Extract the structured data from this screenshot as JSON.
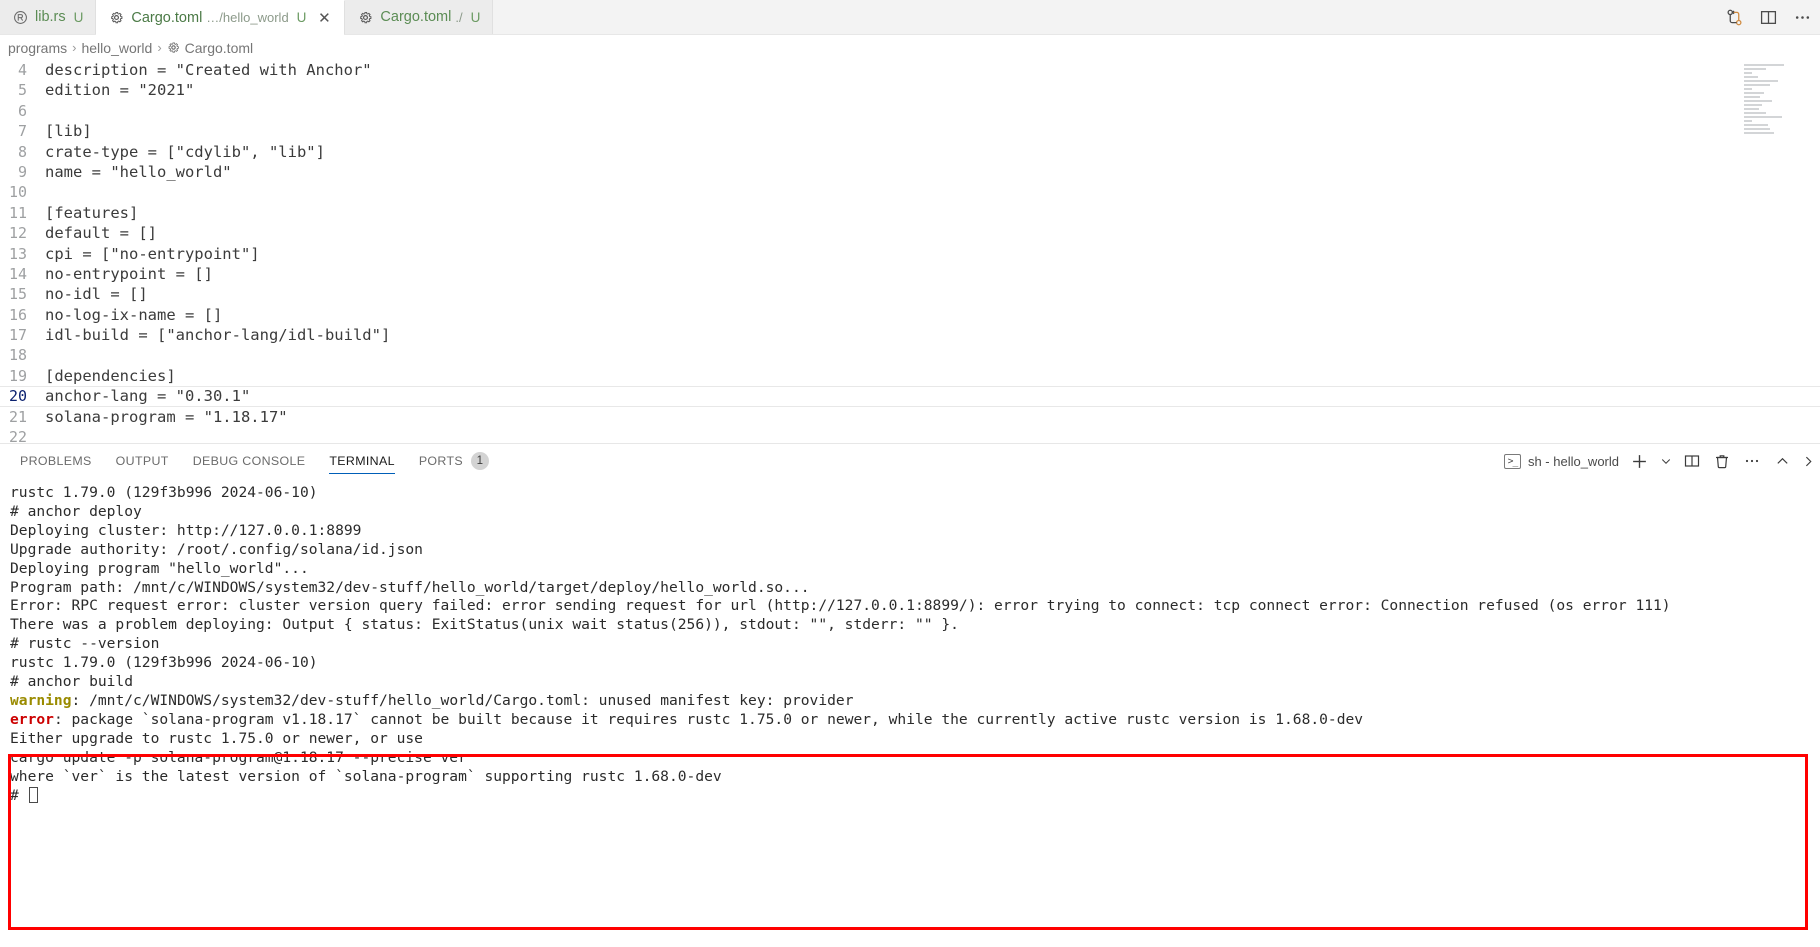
{
  "window": {
    "tabs": [
      {
        "icon": "rust-icon",
        "label": "lib.rs",
        "desc": "",
        "dirty": "U",
        "active": false,
        "closable": false
      },
      {
        "icon": "gear-icon",
        "label": "Cargo.toml",
        "desc": "…/hello_world",
        "dirty": "U",
        "active": true,
        "closable": true
      },
      {
        "icon": "gear-icon",
        "label": "Cargo.toml",
        "desc": "./",
        "dirty": "U",
        "active": false,
        "closable": false
      }
    ],
    "tabbar_actions": [
      {
        "name": "split-editor-right-icon",
        "glyph": "▥"
      },
      {
        "name": "more-actions-icon",
        "glyph": "···"
      }
    ],
    "source_control_icon": "source-control-icon"
  },
  "breadcrumb": {
    "items": [
      "programs",
      "hello_world",
      "Cargo.toml"
    ],
    "separator": "›",
    "file_icon": "gear-icon"
  },
  "editor": {
    "language": "toml",
    "active_line": 20,
    "lines": [
      {
        "n": 4,
        "text": "description = \"Created with Anchor\""
      },
      {
        "n": 5,
        "text": "edition = \"2021\""
      },
      {
        "n": 6,
        "text": ""
      },
      {
        "n": 7,
        "text": "[lib]"
      },
      {
        "n": 8,
        "text": "crate-type = [\"cdylib\", \"lib\"]"
      },
      {
        "n": 9,
        "text": "name = \"hello_world\""
      },
      {
        "n": 10,
        "text": ""
      },
      {
        "n": 11,
        "text": "[features]"
      },
      {
        "n": 12,
        "text": "default = []"
      },
      {
        "n": 13,
        "text": "cpi = [\"no-entrypoint\"]"
      },
      {
        "n": 14,
        "text": "no-entrypoint = []"
      },
      {
        "n": 15,
        "text": "no-idl = []"
      },
      {
        "n": 16,
        "text": "no-log-ix-name = []"
      },
      {
        "n": 17,
        "text": "idl-build = [\"anchor-lang/idl-build\"]"
      },
      {
        "n": 18,
        "text": ""
      },
      {
        "n": 19,
        "text": "[dependencies]"
      },
      {
        "n": 20,
        "text": "anchor-lang = \"0.30.1\""
      },
      {
        "n": 21,
        "text": "solana-program = \"1.18.17\""
      },
      {
        "n": 22,
        "text": ""
      }
    ]
  },
  "panel": {
    "tabs": [
      {
        "label": "PROBLEMS",
        "active": false,
        "badge": ""
      },
      {
        "label": "OUTPUT",
        "active": false,
        "badge": ""
      },
      {
        "label": "DEBUG CONSOLE",
        "active": false,
        "badge": ""
      },
      {
        "label": "TERMINAL",
        "active": true,
        "badge": ""
      },
      {
        "label": "PORTS",
        "active": false,
        "badge": "1"
      }
    ],
    "terminal_selector": {
      "icon": "terminal-icon",
      "icon_glyph": ">_",
      "label": "sh - hello_world"
    },
    "actions": [
      {
        "name": "new-terminal-icon",
        "glyph": "+"
      },
      {
        "name": "chevron-down-icon",
        "glyph": "⌄"
      },
      {
        "name": "split-terminal-icon",
        "glyph": "▥"
      },
      {
        "name": "kill-terminal-icon",
        "glyph": "🗑"
      },
      {
        "name": "views-and-more-actions-icon",
        "glyph": "···"
      },
      {
        "name": "maximize-panel-icon",
        "glyph": "⌃"
      },
      {
        "name": "close-panel-icon",
        "glyph": "✕"
      }
    ]
  },
  "terminal": {
    "highlight_color": "#ff0000",
    "lines": [
      {
        "segments": [
          {
            "t": "rustc 1.79.0 (129f3b996 2024-06-10)"
          }
        ]
      },
      {
        "segments": [
          {
            "t": "# anchor deploy"
          }
        ]
      },
      {
        "segments": [
          {
            "t": "Deploying cluster: http://127.0.0.1:8899"
          }
        ]
      },
      {
        "segments": [
          {
            "t": "Upgrade authority: /root/.config/solana/id.json"
          }
        ]
      },
      {
        "segments": [
          {
            "t": "Deploying program \"hello_world\"..."
          }
        ]
      },
      {
        "segments": [
          {
            "t": "Program path: /mnt/c/WINDOWS/system32/dev-stuff/hello_world/target/deploy/hello_world.so..."
          }
        ]
      },
      {
        "segments": [
          {
            "t": "Error: RPC request error: cluster version query failed: error sending request for url (http://127.0.0.1:8899/): error trying to connect: tcp connect error: Connection refused (os error 111)"
          }
        ]
      },
      {
        "segments": [
          {
            "t": "There was a problem deploying: Output { status: ExitStatus(unix wait status(256)), stdout: \"\", stderr: \"\" }."
          }
        ]
      },
      {
        "segments": [
          {
            "t": "# rustc --version"
          }
        ]
      },
      {
        "segments": [
          {
            "t": "rustc 1.79.0 (129f3b996 2024-06-10)"
          }
        ]
      },
      {
        "segments": [
          {
            "t": "# anchor build"
          }
        ]
      },
      {
        "segments": [
          {
            "t": "warning",
            "c": "warn"
          },
          {
            "t": ": /mnt/c/WINDOWS/system32/dev-stuff/hello_world/Cargo.toml: unused manifest key: provider"
          }
        ]
      },
      {
        "segments": [
          {
            "t": "error",
            "c": "err"
          },
          {
            "t": ": package `solana-program v1.18.17` cannot be built because it requires rustc 1.75.0 or newer, while the currently active rustc version is 1.68.0-dev"
          }
        ]
      },
      {
        "segments": [
          {
            "t": "Either upgrade to rustc 1.75.0 or newer, or use"
          }
        ]
      },
      {
        "segments": [
          {
            "t": "cargo update -p solana-program@1.18.17 --precise ver"
          }
        ]
      },
      {
        "segments": [
          {
            "t": "where `ver` is the latest version of `solana-program` supporting rustc 1.68.0-dev"
          }
        ]
      },
      {
        "segments": [
          {
            "t": "# "
          }
        ],
        "cursor": true
      }
    ]
  }
}
